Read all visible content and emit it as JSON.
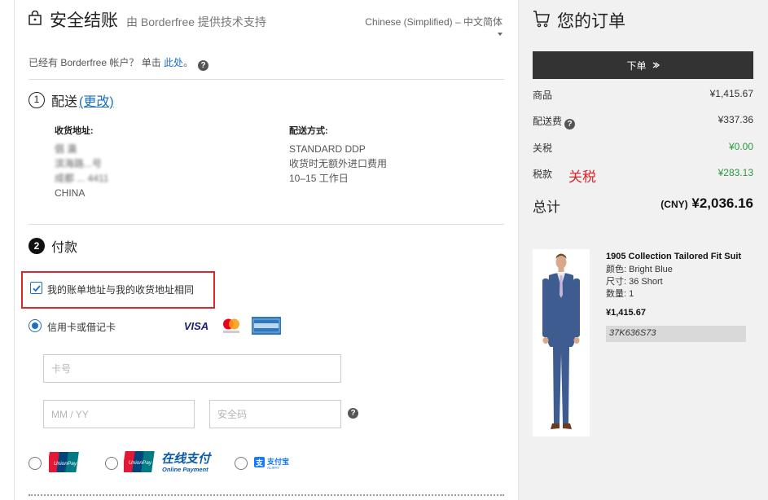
{
  "header": {
    "title": "安全结账",
    "subtitle": "由 Borderfree 提供技术支持",
    "language": "Chinese (Simplified) – 中文简体",
    "account_prefix": "已经有 Borderfree 帐户？ 单击",
    "account_link": "此处",
    "account_suffix": "。"
  },
  "shipping": {
    "step_number": "1",
    "step_label": "配送",
    "edit_label": "(更改)",
    "address_heading": "收货地址:",
    "address_lines": [
      "倡 瀛",
      "滨海路...号",
      "成都 ... 4411",
      "CHINA"
    ],
    "method_heading": "配送方式:",
    "method_lines": [
      "STANDARD DDP",
      "收货时无额外进口费用",
      "10–15 工作日"
    ]
  },
  "payment": {
    "step_number": "2",
    "step_label": "付款",
    "same_address_label": "我的账单地址与我的收货地址相同",
    "same_address_checked": true,
    "card_option_label": "信用卡或借记卡",
    "card_brands": [
      "VISA",
      "MasterCard",
      "AMERICAN EXPRESS"
    ],
    "card_number_placeholder": "卡号",
    "expiry_placeholder": "MM / YY",
    "cvv_placeholder": "安全码",
    "alt_methods": [
      "UnionPay 银联",
      "UnionPay 银联 在线支付 Online Payment",
      "支付宝 ALIPAY"
    ]
  },
  "order": {
    "title": "您的订单",
    "place_order_label": "下单",
    "items_label": "商品",
    "items_value": "¥1,415.67",
    "shipping_label": "配送费",
    "shipping_value": "¥337.36",
    "duty_label": "关税",
    "duty_value": "¥0.00",
    "tax_label": "税款",
    "tax_annotation": "关税",
    "tax_value": "¥283.13",
    "total_label": "总计",
    "total_currency": "(CNY)",
    "total_value": "¥2,036.16",
    "product": {
      "name": "1905 Collection Tailored Fit Suit",
      "color": "颜色: Bright Blue",
      "size": "尺寸: 36 Short",
      "qty": "数量: 1",
      "price": "¥1,415.67",
      "sku": "37K636S73"
    }
  },
  "colors": {
    "accent": "#1a6fc6",
    "highlight_box": "#e0242b",
    "green_value": "#2a9a3a",
    "button_bg": "#333333"
  }
}
